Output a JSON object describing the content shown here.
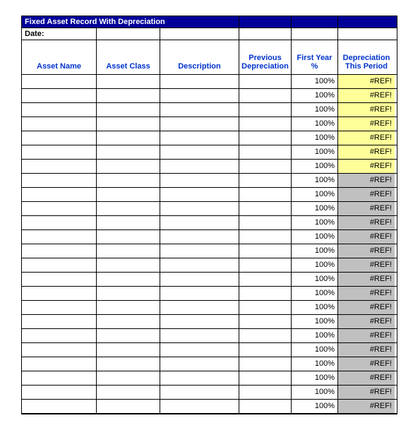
{
  "title": "Fixed Asset Record With Depreciation",
  "date_label": "Date:",
  "headers": {
    "asset_name": "Asset Name",
    "asset_class": "Asset Class",
    "description": "Description",
    "previous_depreciation": "Previous Depreciation",
    "first_year_pct": "First Year %",
    "depreciation_this_period": "Depreciation This Period"
  },
  "rows": [
    {
      "asset_name": "",
      "asset_class": "",
      "description": "",
      "previous_depreciation": "",
      "first_year_pct": "100%",
      "depreciation_this_period": "#REF!",
      "fill": "yellow"
    },
    {
      "asset_name": "",
      "asset_class": "",
      "description": "",
      "previous_depreciation": "",
      "first_year_pct": "100%",
      "depreciation_this_period": "#REF!",
      "fill": "yellow"
    },
    {
      "asset_name": "",
      "asset_class": "",
      "description": "",
      "previous_depreciation": "",
      "first_year_pct": "100%",
      "depreciation_this_period": "#REF!",
      "fill": "yellow"
    },
    {
      "asset_name": "",
      "asset_class": "",
      "description": "",
      "previous_depreciation": "",
      "first_year_pct": "100%",
      "depreciation_this_period": "#REF!",
      "fill": "yellow"
    },
    {
      "asset_name": "",
      "asset_class": "",
      "description": "",
      "previous_depreciation": "",
      "first_year_pct": "100%",
      "depreciation_this_period": "#REF!",
      "fill": "yellow"
    },
    {
      "asset_name": "",
      "asset_class": "",
      "description": "",
      "previous_depreciation": "",
      "first_year_pct": "100%",
      "depreciation_this_period": "#REF!",
      "fill": "yellow"
    },
    {
      "asset_name": "",
      "asset_class": "",
      "description": "",
      "previous_depreciation": "",
      "first_year_pct": "100%",
      "depreciation_this_period": "#REF!",
      "fill": "yellow"
    },
    {
      "asset_name": "",
      "asset_class": "",
      "description": "",
      "previous_depreciation": "",
      "first_year_pct": "100%",
      "depreciation_this_period": "#REF!",
      "fill": "grey"
    },
    {
      "asset_name": "",
      "asset_class": "",
      "description": "",
      "previous_depreciation": "",
      "first_year_pct": "100%",
      "depreciation_this_period": "#REF!",
      "fill": "grey"
    },
    {
      "asset_name": "",
      "asset_class": "",
      "description": "",
      "previous_depreciation": "",
      "first_year_pct": "100%",
      "depreciation_this_period": "#REF!",
      "fill": "grey"
    },
    {
      "asset_name": "",
      "asset_class": "",
      "description": "",
      "previous_depreciation": "",
      "first_year_pct": "100%",
      "depreciation_this_period": "#REF!",
      "fill": "grey"
    },
    {
      "asset_name": "",
      "asset_class": "",
      "description": "",
      "previous_depreciation": "",
      "first_year_pct": "100%",
      "depreciation_this_period": "#REF!",
      "fill": "grey"
    },
    {
      "asset_name": "",
      "asset_class": "",
      "description": "",
      "previous_depreciation": "",
      "first_year_pct": "100%",
      "depreciation_this_period": "#REF!",
      "fill": "grey"
    },
    {
      "asset_name": "",
      "asset_class": "",
      "description": "",
      "previous_depreciation": "",
      "first_year_pct": "100%",
      "depreciation_this_period": "#REF!",
      "fill": "grey"
    },
    {
      "asset_name": "",
      "asset_class": "",
      "description": "",
      "previous_depreciation": "",
      "first_year_pct": "100%",
      "depreciation_this_period": "#REF!",
      "fill": "grey"
    },
    {
      "asset_name": "",
      "asset_class": "",
      "description": "",
      "previous_depreciation": "",
      "first_year_pct": "100%",
      "depreciation_this_period": "#REF!",
      "fill": "grey"
    },
    {
      "asset_name": "",
      "asset_class": "",
      "description": "",
      "previous_depreciation": "",
      "first_year_pct": "100%",
      "depreciation_this_period": "#REF!",
      "fill": "grey"
    },
    {
      "asset_name": "",
      "asset_class": "",
      "description": "",
      "previous_depreciation": "",
      "first_year_pct": "100%",
      "depreciation_this_period": "#REF!",
      "fill": "grey"
    },
    {
      "asset_name": "",
      "asset_class": "",
      "description": "",
      "previous_depreciation": "",
      "first_year_pct": "100%",
      "depreciation_this_period": "#REF!",
      "fill": "grey"
    },
    {
      "asset_name": "",
      "asset_class": "",
      "description": "",
      "previous_depreciation": "",
      "first_year_pct": "100%",
      "depreciation_this_period": "#REF!",
      "fill": "grey"
    },
    {
      "asset_name": "",
      "asset_class": "",
      "description": "",
      "previous_depreciation": "",
      "first_year_pct": "100%",
      "depreciation_this_period": "#REF!",
      "fill": "grey"
    },
    {
      "asset_name": "",
      "asset_class": "",
      "description": "",
      "previous_depreciation": "",
      "first_year_pct": "100%",
      "depreciation_this_period": "#REF!",
      "fill": "grey"
    },
    {
      "asset_name": "",
      "asset_class": "",
      "description": "",
      "previous_depreciation": "",
      "first_year_pct": "100%",
      "depreciation_this_period": "#REF!",
      "fill": "grey"
    },
    {
      "asset_name": "",
      "asset_class": "",
      "description": "",
      "previous_depreciation": "",
      "first_year_pct": "100%",
      "depreciation_this_period": "#REF!",
      "fill": "grey"
    }
  ]
}
